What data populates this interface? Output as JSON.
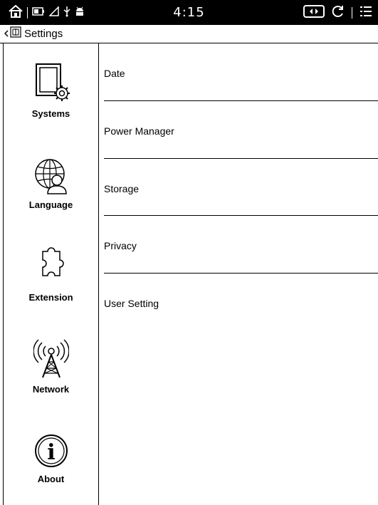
{
  "status_bar": {
    "time": "4:15",
    "icons_left": [
      "home-icon",
      "battery-icon",
      "signal-icon",
      "usb-icon",
      "android-icon"
    ],
    "icons_right": [
      "screen-rotate-icon",
      "refresh-icon",
      "menu-icon"
    ]
  },
  "title_bar": {
    "title": "Settings"
  },
  "sidebar": {
    "items": [
      {
        "label": "Systems",
        "icon": "tablet-gear-icon"
      },
      {
        "label": "Language",
        "icon": "globe-user-icon"
      },
      {
        "label": "Extension",
        "icon": "puzzle-icon"
      },
      {
        "label": "Network",
        "icon": "antenna-icon"
      },
      {
        "label": "About",
        "icon": "info-icon"
      }
    ]
  },
  "main": {
    "items": [
      {
        "label": "Date"
      },
      {
        "label": "Power Manager"
      },
      {
        "label": "Storage"
      },
      {
        "label": "Privacy"
      },
      {
        "label": "User Setting"
      }
    ]
  }
}
